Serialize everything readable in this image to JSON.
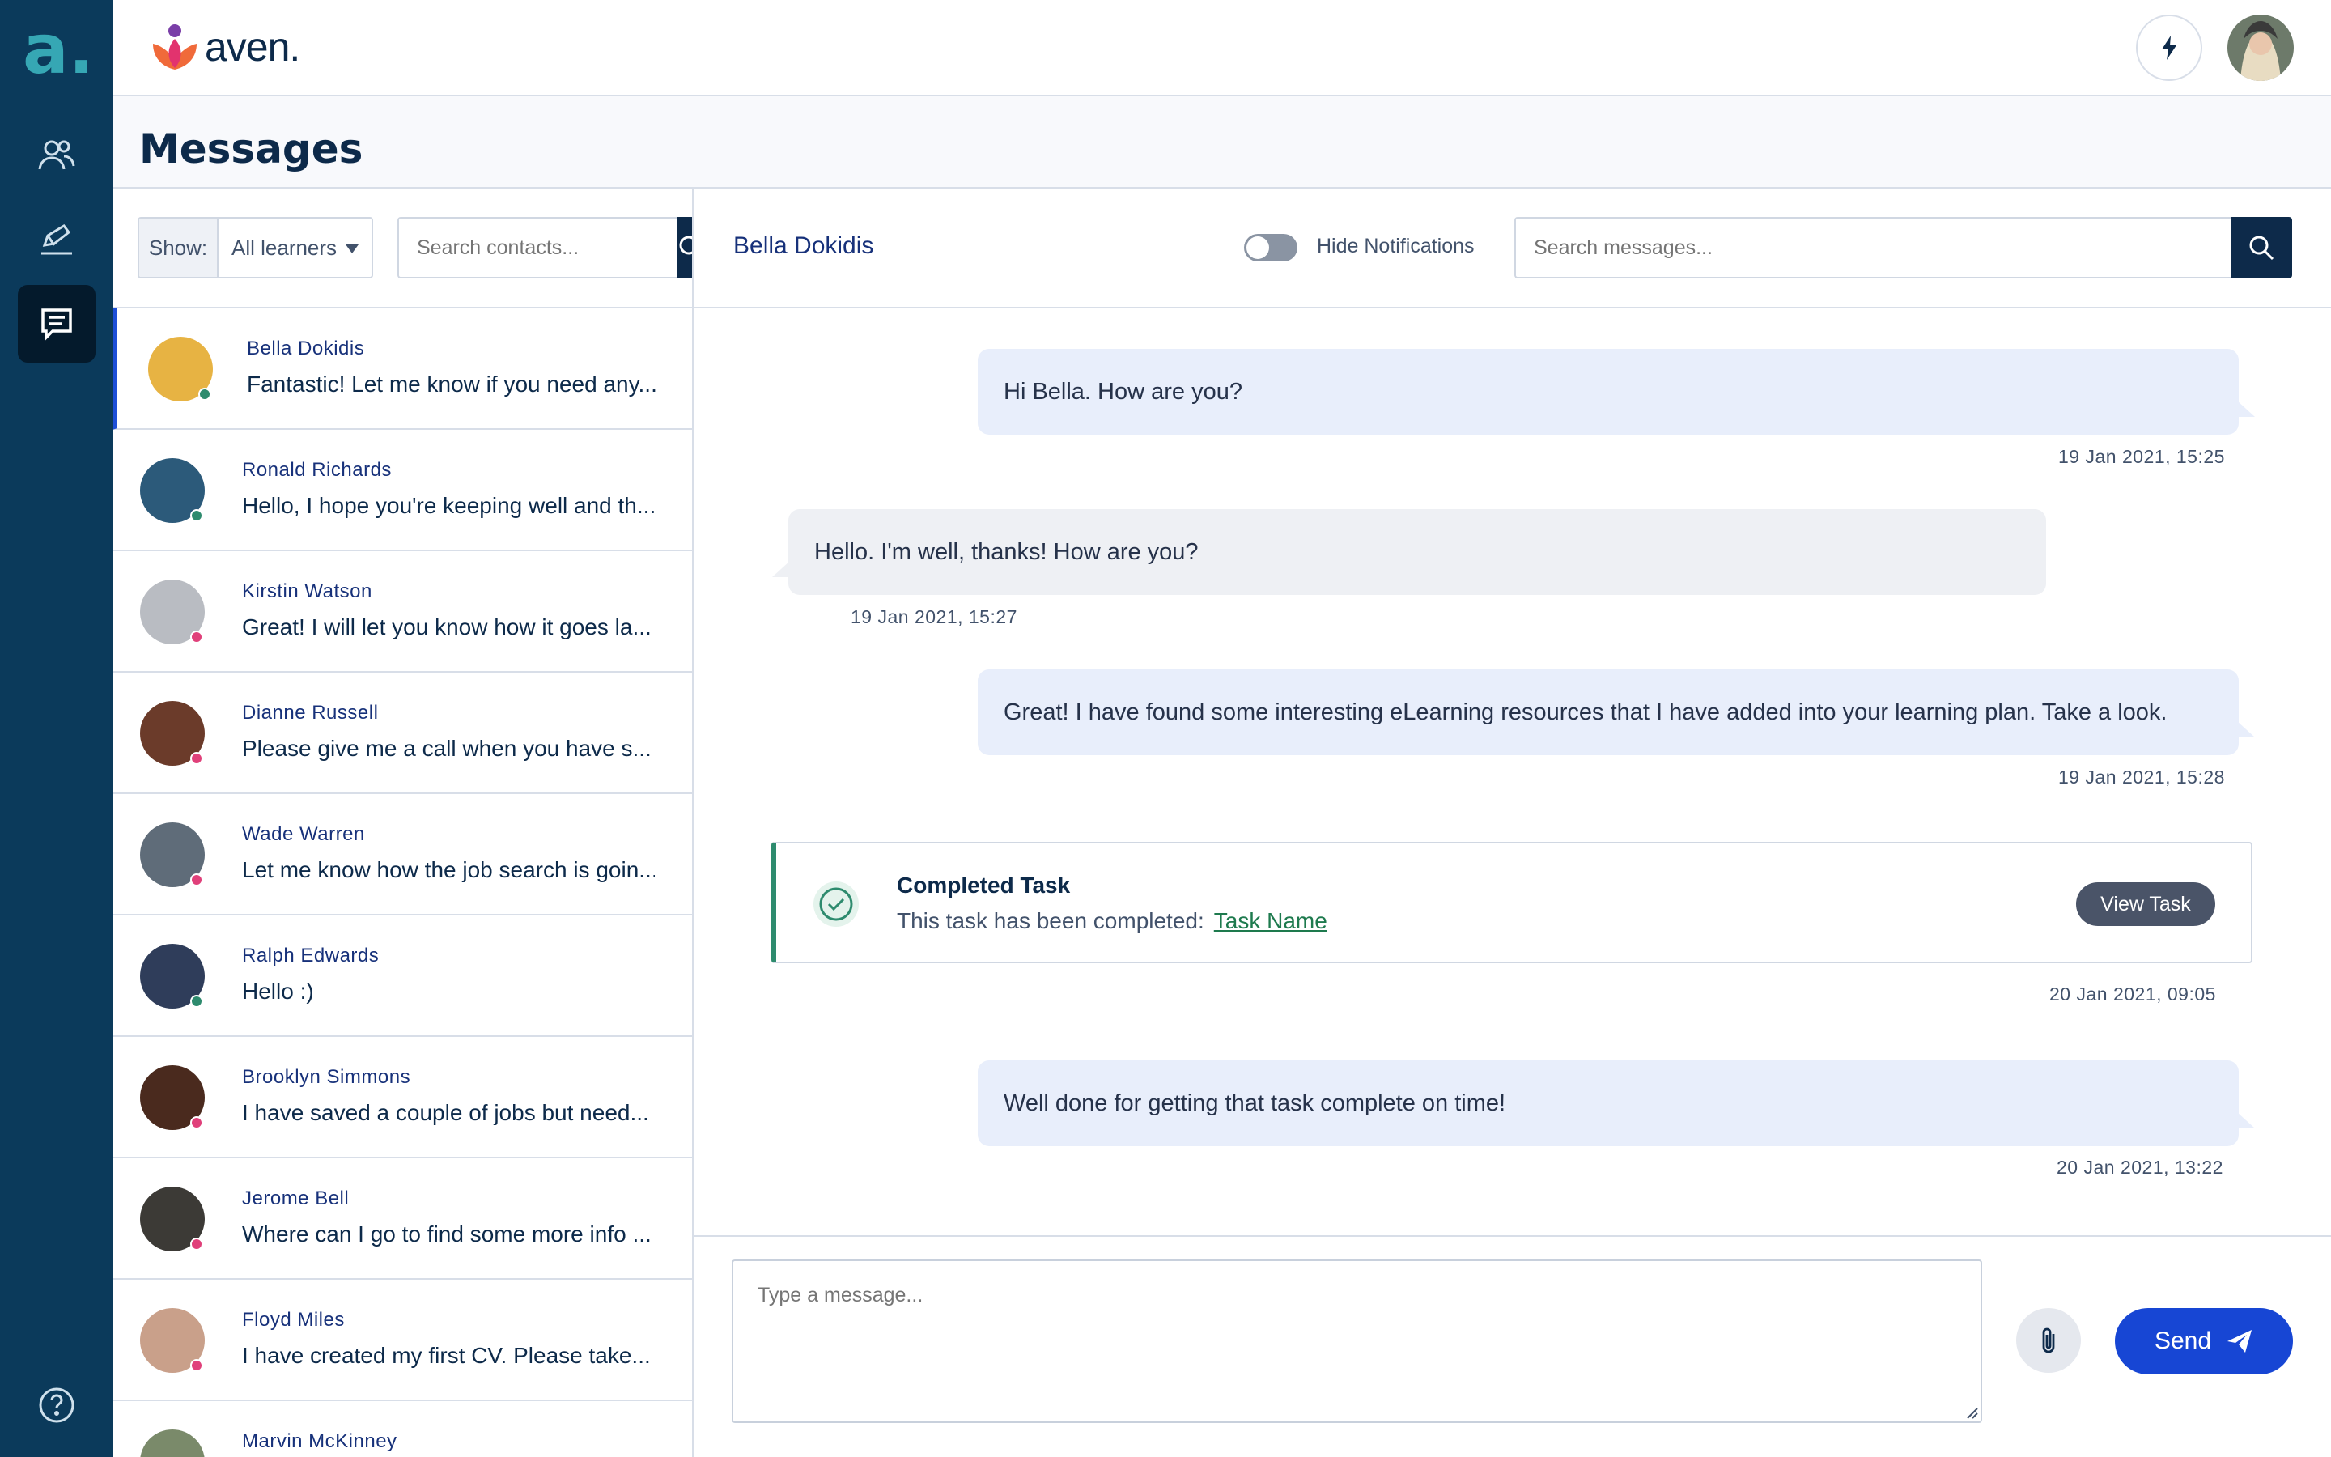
{
  "app": {
    "rail_logo": "a.",
    "brand_name": "aven."
  },
  "rail": {
    "items": [
      {
        "icon": "people-icon"
      },
      {
        "icon": "pen-icon"
      },
      {
        "icon": "chat-icon",
        "active": true
      },
      {
        "icon": "help-icon"
      }
    ]
  },
  "header": {
    "title": "Messages"
  },
  "contacts_panel": {
    "show_label": "Show:",
    "show_value": "All learners",
    "search_placeholder": "Search contacts..."
  },
  "contacts": [
    {
      "name": "Bella Dokidis",
      "preview": "Fantastic! Let me know if you need any...",
      "status_color": "#2e8b6e",
      "avatar_color": "#e7b343",
      "active": true
    },
    {
      "name": "Ronald Richards",
      "preview": "Hello, I hope you're keeping well and th...",
      "status_color": "#2e8b6e",
      "avatar_color": "#2c5a7a"
    },
    {
      "name": "Kirstin Watson",
      "preview": "Great! I will let you know how it goes la...",
      "status_color": "#e0407a",
      "avatar_color": "#b9bcc2"
    },
    {
      "name": "Dianne Russell",
      "preview": "Please give me a call when you have s...",
      "status_color": "#e0407a",
      "avatar_color": "#6b3b2a"
    },
    {
      "name": "Wade Warren",
      "preview": "Let me know how the job search is goin...",
      "status_color": "#e0407a",
      "avatar_color": "#5f6c79"
    },
    {
      "name": "Ralph Edwards",
      "preview": "Hello :)",
      "status_color": "#2e8b6e",
      "avatar_color": "#2f3d5a"
    },
    {
      "name": "Brooklyn Simmons",
      "preview": "I have saved a couple of jobs but need...",
      "status_color": "#e0407a",
      "avatar_color": "#4a2a1e"
    },
    {
      "name": "Jerome Bell",
      "preview": "Where can I go to find some more info ...",
      "status_color": "#e0407a",
      "avatar_color": "#3c3a36"
    },
    {
      "name": "Floyd Miles",
      "preview": "I have created my first CV. Please take...",
      "status_color": "#e0407a",
      "avatar_color": "#c9a08a"
    },
    {
      "name": "Marvin McKinney",
      "preview": "",
      "status_color": "#2e8b6e",
      "avatar_color": "#7a8a6a"
    }
  ],
  "chat": {
    "contact_name": "Bella Dokidis",
    "toggle_label": "Hide Notifications",
    "search_placeholder": "Search messages...",
    "messages": [
      {
        "direction": "out",
        "text": "Hi Bella. How are you?",
        "time": "19 Jan 2021, 15:25"
      },
      {
        "direction": "in",
        "text": "Hello. I'm well, thanks! How are you?",
        "time": "19 Jan 2021, 15:27"
      },
      {
        "direction": "out",
        "text": "Great! I have found some interesting eLearning resources that I have added into your learning plan. Take a look.",
        "time": "19 Jan 2021, 15:28"
      },
      {
        "direction": "out",
        "text": "Well done for getting that task complete on time!",
        "time": "20 Jan 2021, 13:22"
      }
    ],
    "task_card": {
      "title": "Completed Task",
      "description": "This task has been completed:",
      "link_text": "Task Name",
      "button_label": "View Task",
      "time": "20 Jan 2021, 09:05"
    },
    "composer": {
      "placeholder": "Type a message...",
      "send_label": "Send"
    }
  },
  "colors": {
    "rail": "#0b3a5b",
    "accent_blue": "#1746d4",
    "dark_navy": "#0d2a4a",
    "online": "#2e8b6e",
    "offline": "#e0407a"
  }
}
